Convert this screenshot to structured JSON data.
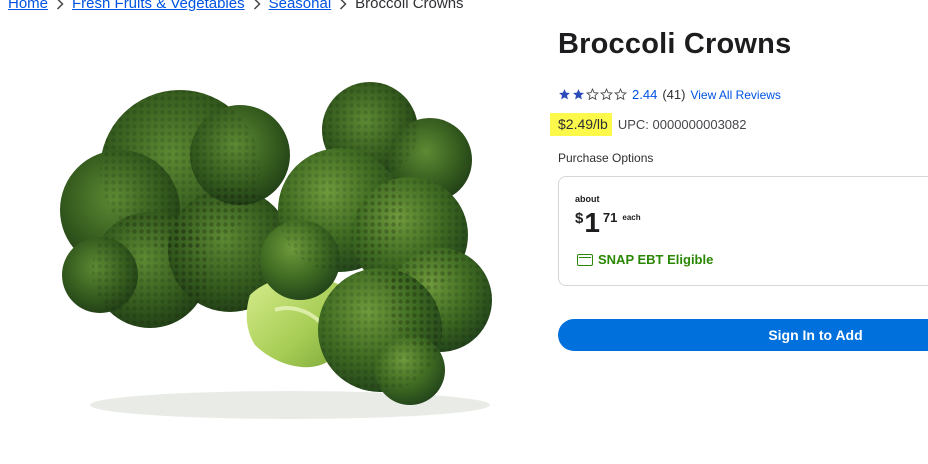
{
  "breadcrumb": {
    "items": [
      {
        "label": "Home"
      },
      {
        "label": "Fresh Fruits & Vegetables"
      },
      {
        "label": "Seasonal"
      }
    ],
    "current": "Broccoli Crowns",
    "separator_icon": "chevron-right-icon"
  },
  "product": {
    "title": "Broccoli Crowns",
    "image_alt": "broccoli-crowns-image",
    "rating": {
      "value": "2.44",
      "stars_filled": 2,
      "stars_total": 5,
      "count": "(41)",
      "reviews_link": "View All Reviews"
    },
    "unit_price": "$2.49/lb",
    "upc": "UPC: 0000000003082"
  },
  "purchase": {
    "label": "Purchase Options",
    "about": "about",
    "currency": "$",
    "dollars": "1",
    "cents": "71",
    "each": "each",
    "snap_label": "SNAP EBT Eligible",
    "snap_icon": "ebt-card-icon"
  },
  "cta": {
    "label": "Sign In to Add"
  },
  "colors": {
    "link": "#0053e2",
    "highlight": "#fcf94a",
    "snap_green": "#2a8703",
    "button_blue": "#0071dc"
  }
}
